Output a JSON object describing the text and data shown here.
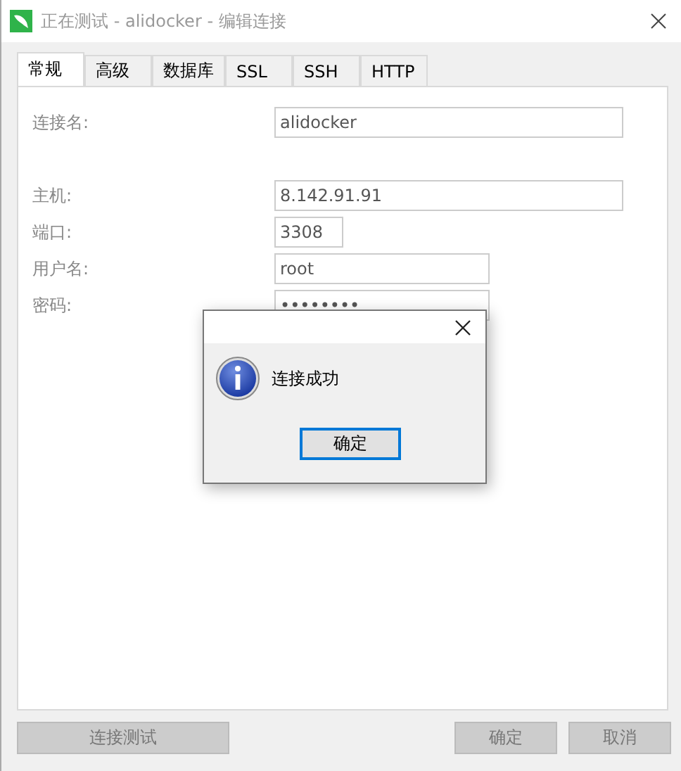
{
  "window": {
    "title": "正在测试 - alidocker - 编辑连接",
    "disabled": true
  },
  "tabs": [
    {
      "label": "常规",
      "selected": true
    },
    {
      "label": "高级",
      "selected": false
    },
    {
      "label": "数据库",
      "selected": false
    },
    {
      "label": "SSL",
      "selected": false
    },
    {
      "label": "SSH",
      "selected": false
    },
    {
      "label": "HTTP",
      "selected": false
    }
  ],
  "field_groups": [
    [
      {
        "label": "连接名:",
        "value": "alidocker",
        "kind": "wide"
      }
    ],
    [
      {
        "label": "主机:",
        "value": "8.142.91.91",
        "kind": "wide"
      },
      {
        "label": "端口:",
        "value": "3308",
        "kind": "short"
      },
      {
        "label": "用户名:",
        "value": "root",
        "kind": "medium"
      },
      {
        "label": "密码:",
        "value": "••••••••",
        "kind": "medium"
      }
    ]
  ],
  "buttons": [
    {
      "label": "连接测试",
      "disabled": true
    },
    {
      "label": "确定",
      "disabled": true
    },
    {
      "label": "取消",
      "disabled": true
    }
  ],
  "dialog": {
    "message": "连接成功",
    "button": {
      "label": "确定",
      "default": true
    }
  }
}
